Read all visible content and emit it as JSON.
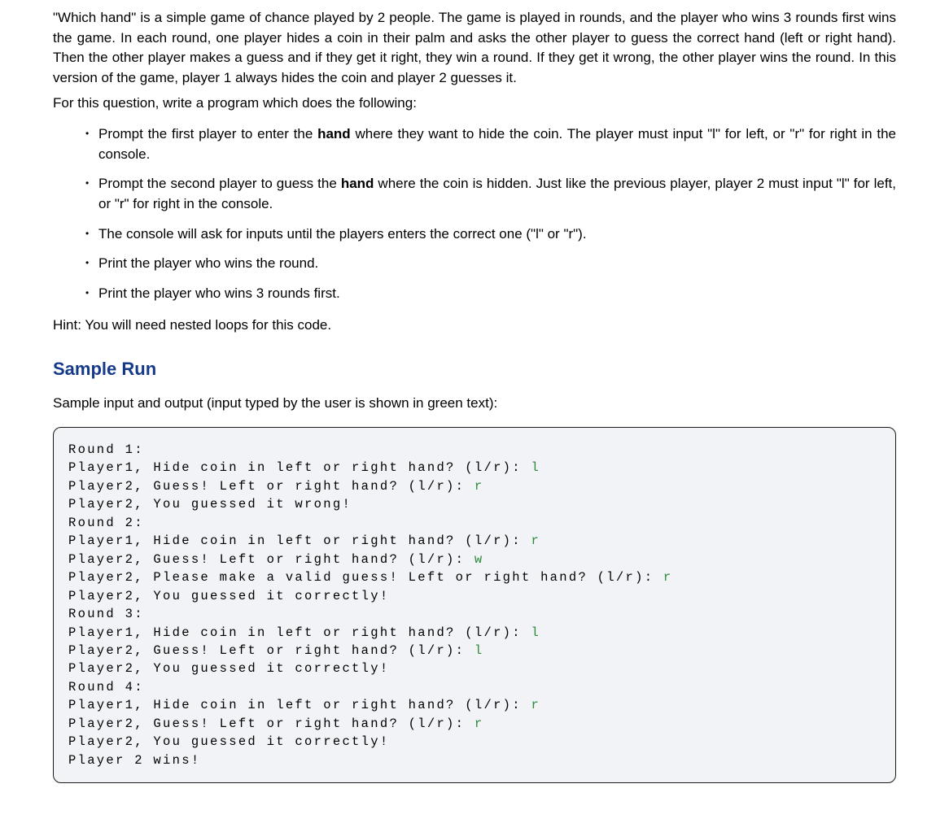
{
  "intro": "\"Which hand\" is a simple game of chance played by 2 people. The game is played in rounds, and the player who wins 3 rounds first wins the game. In each round, one player hides a coin in their palm and asks the other player to guess the correct hand (left or right hand). Then the other player makes a guess and if they get it right, they win a round. If they get it wrong, the other player wins the round. In this version of the game, player 1 always hides the coin and player 2 guesses it.",
  "lead": "For this question, write a program which does the following:",
  "bullets": {
    "b1_pre": "Prompt the first player to enter the ",
    "b1_bold": "hand",
    "b1_post": " where they want to hide the coin. The player must input \"l\" for left, or \"r\" for right in the console.",
    "b2_pre": "Prompt the second player to guess the ",
    "b2_bold": "hand",
    "b2_post": " where the coin is hidden. Just like the previous player, player 2 must input \"l\" for left, or \"r\" for right in the console.",
    "b3": "The console will ask for inputs until the players enters the correct one (\"l\" or \"r\").",
    "b4": "Print the player who wins the round.",
    "b5": "Print the player who wins 3 rounds first."
  },
  "hint": "Hint: You will need nested loops for this code.",
  "sample_run_heading": "Sample Run",
  "sample_lead": "Sample input and output (input typed by the user is shown in green text):",
  "code": {
    "l1": "Round 1:",
    "l2p": "Player1, Hide coin in left or right hand? (l/r): ",
    "l2i": "l",
    "l3p": "Player2, Guess! Left or right hand? (l/r): ",
    "l3i": "r",
    "l4": "Player2, You guessed it wrong!",
    "l5": "Round 2:",
    "l6p": "Player1, Hide coin in left or right hand? (l/r): ",
    "l6i": "r",
    "l7p": "Player2, Guess! Left or right hand? (l/r): ",
    "l7i": "w",
    "l8p": "Player2, Please make a valid guess! Left or right hand? (l/r): ",
    "l8i": "r",
    "l9": "Player2, You guessed it correctly!",
    "l10": "Round 3:",
    "l11p": "Player1, Hide coin in left or right hand? (l/r): ",
    "l11i": "l",
    "l12p": "Player2, Guess! Left or right hand? (l/r): ",
    "l12i": "l",
    "l13": "Player2, You guessed it correctly!",
    "l14": "Round 4:",
    "l15p": "Player1, Hide coin in left or right hand? (l/r): ",
    "l15i": "r",
    "l16p": "Player2, Guess! Left or right hand? (l/r): ",
    "l16i": "r",
    "l17": "Player2, You guessed it correctly!",
    "l18": "Player 2 wins!"
  }
}
